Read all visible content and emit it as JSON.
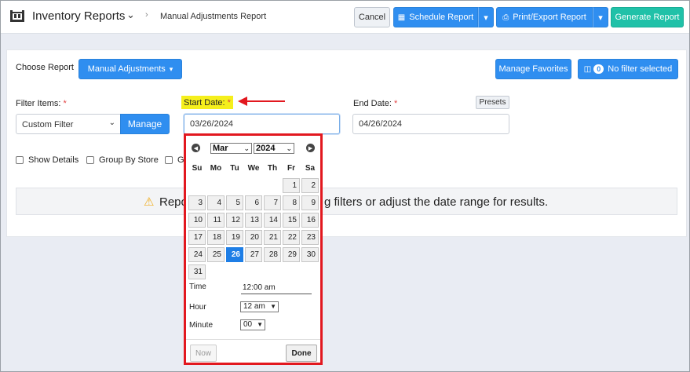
{
  "header": {
    "app_title": "Inventory Reports",
    "breadcrumb": "Manual Adjustments Report",
    "cancel_label": "Cancel",
    "schedule_label": "Schedule Report",
    "print_label": "Print/Export Report",
    "generate_label": "Generate Report",
    "accent_color": "#2f8ef0",
    "generate_color": "#20c1a8"
  },
  "report": {
    "choose_label": "Choose Report",
    "selected_report": "Manual Adjustments",
    "manage_favorites_label": "Manage Favorites",
    "filter_count": "0",
    "no_filter_label": "No filter selected"
  },
  "filters": {
    "filter_items_label": "Filter Items:",
    "required_mark": "*",
    "filter_value": "Custom Filter",
    "manage_label": "Manage",
    "start_date_label": "Start Date:",
    "start_date_value": "03/26/2024",
    "end_date_label": "End Date:",
    "end_date_value": "04/26/2024",
    "presets_label": "Presets",
    "highlight_color": "#f5ef1c",
    "annotation_color": "#e2181f"
  },
  "options": {
    "show_details": "Show Details",
    "group_by_store": "Group By Store",
    "third_option_partial": "G"
  },
  "notice": {
    "text_left": "Repo",
    "text_right": "g filters or adjust the date range for results."
  },
  "calendar": {
    "month": "Mar",
    "year": "2024",
    "weekdays": [
      "Su",
      "Mo",
      "Tu",
      "We",
      "Th",
      "Fr",
      "Sa"
    ],
    "days": [
      "1",
      "2",
      "3",
      "4",
      "5",
      "6",
      "7",
      "8",
      "9",
      "10",
      "11",
      "12",
      "13",
      "14",
      "15",
      "16",
      "17",
      "18",
      "19",
      "20",
      "21",
      "22",
      "23",
      "24",
      "25",
      "26",
      "27",
      "28",
      "29",
      "30",
      "31"
    ],
    "selected_day": "26",
    "time_label": "Time",
    "time_value": "12:00 am",
    "hour_label": "Hour",
    "hour_value": "12 am",
    "minute_label": "Minute",
    "minute_value": "00",
    "now_label": "Now",
    "done_label": "Done"
  }
}
